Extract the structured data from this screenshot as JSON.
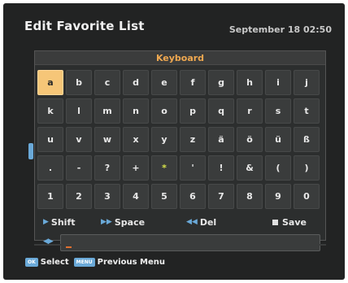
{
  "header": {
    "title": "Edit Favorite List",
    "datetime": "September 18 02:50"
  },
  "keyboard": {
    "title": "Keyboard",
    "rows": [
      [
        "a",
        "b",
        "c",
        "d",
        "e",
        "f",
        "g",
        "h",
        "i",
        "j"
      ],
      [
        "k",
        "l",
        "m",
        "n",
        "o",
        "p",
        "q",
        "r",
        "s",
        "t"
      ],
      [
        "u",
        "v",
        "w",
        "x",
        "y",
        "z",
        "ä",
        "ö",
        "ü",
        "ß"
      ],
      [
        ".",
        "-",
        "?",
        "+",
        "*",
        "'",
        "!",
        "&",
        "(",
        ")"
      ],
      [
        "1",
        "2",
        "3",
        "4",
        "5",
        "6",
        "7",
        "8",
        "9",
        "0"
      ]
    ],
    "selected": "a",
    "functions": {
      "shift": "Shift",
      "space": "Space",
      "del": "Del",
      "save": "Save"
    },
    "input_value": ""
  },
  "footer": {
    "ok_badge": "OK",
    "ok_label": "Select",
    "menu_badge": "MENU",
    "menu_label": "Previous Menu"
  },
  "colors": {
    "selected_key": "#f6c678",
    "accent": "#6aa9d8",
    "title_accent": "#f0a850"
  }
}
